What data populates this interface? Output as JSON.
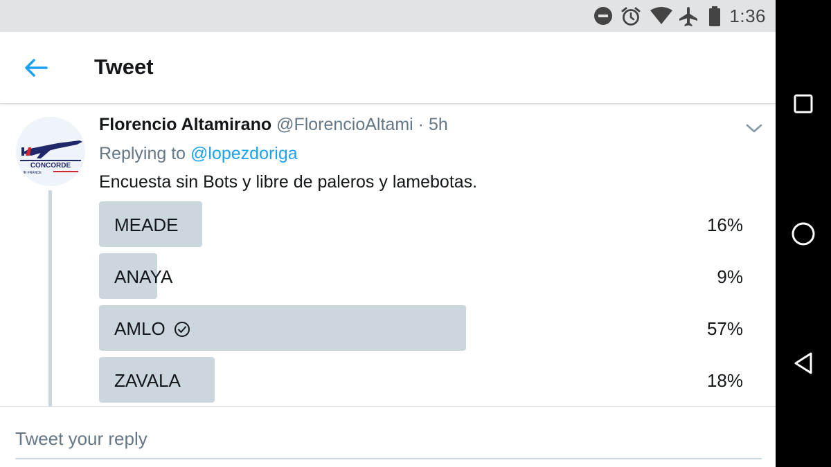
{
  "status_bar": {
    "time": "1:36",
    "icons": [
      "do-not-disturb-icon",
      "alarm-icon",
      "wifi-icon",
      "airplane-mode-icon",
      "battery-icon"
    ]
  },
  "app_bar": {
    "title": "Tweet",
    "back_icon": "back-arrow-icon"
  },
  "tweet": {
    "author_name": "Florencio Altamirano",
    "author_handle": "@FlorencioAltami",
    "separator": "·",
    "time": "5h",
    "replying_prefix": "Replying to",
    "replying_handle": "@lopezdoriga",
    "text": "Encuesta sin Bots y libre de paleros y lamebotas.",
    "avatar": {
      "logo_text": "CONCORDE",
      "logo_subtext": "AIR FRANCE"
    },
    "menu_icon": "chevron-down-icon"
  },
  "poll": {
    "options": [
      {
        "label": "MEADE",
        "percent_text": "16%",
        "percent": 16,
        "selected": false
      },
      {
        "label": "ANAYA",
        "percent_text": "9%",
        "percent": 9,
        "selected": false
      },
      {
        "label": "AMLO",
        "percent_text": "57%",
        "percent": 57,
        "selected": true
      },
      {
        "label": "ZAVALA",
        "percent_text": "18%",
        "percent": 18,
        "selected": false
      }
    ]
  },
  "composer": {
    "placeholder": "Tweet your reply"
  },
  "nav_bar": {
    "buttons": [
      "recents-square-icon",
      "home-circle-icon",
      "back-triangle-icon"
    ]
  },
  "colors": {
    "link_blue": "#1da1f2",
    "poll_bar": "#ccd6dd",
    "text_dark": "#14171a",
    "text_gray": "#657786",
    "status_bar_bg": "#e1e3e5"
  }
}
